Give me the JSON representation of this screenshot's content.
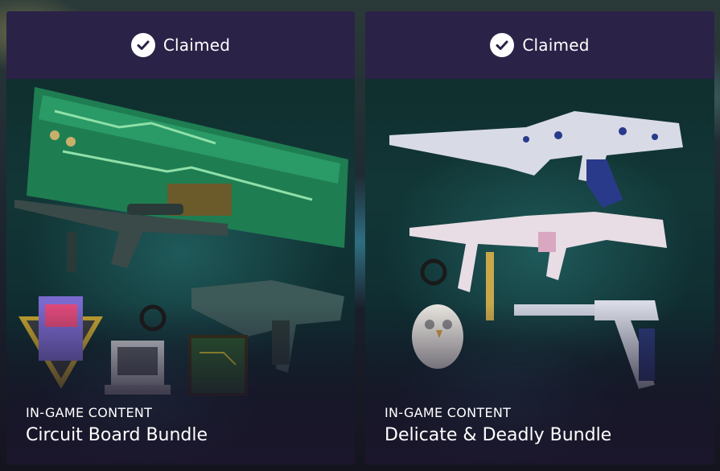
{
  "cards": [
    {
      "status": "Claimed",
      "category": "IN-GAME CONTENT",
      "title": "Circuit Board Bundle",
      "status_icon": "check-circle-icon"
    },
    {
      "status": "Claimed",
      "category": "IN-GAME CONTENT",
      "title": "Delicate & Deadly Bundle",
      "status_icon": "check-circle-icon"
    }
  ],
  "colors": {
    "header": "#2b2247",
    "text": "#ffffff",
    "card_bg": "#123636"
  }
}
